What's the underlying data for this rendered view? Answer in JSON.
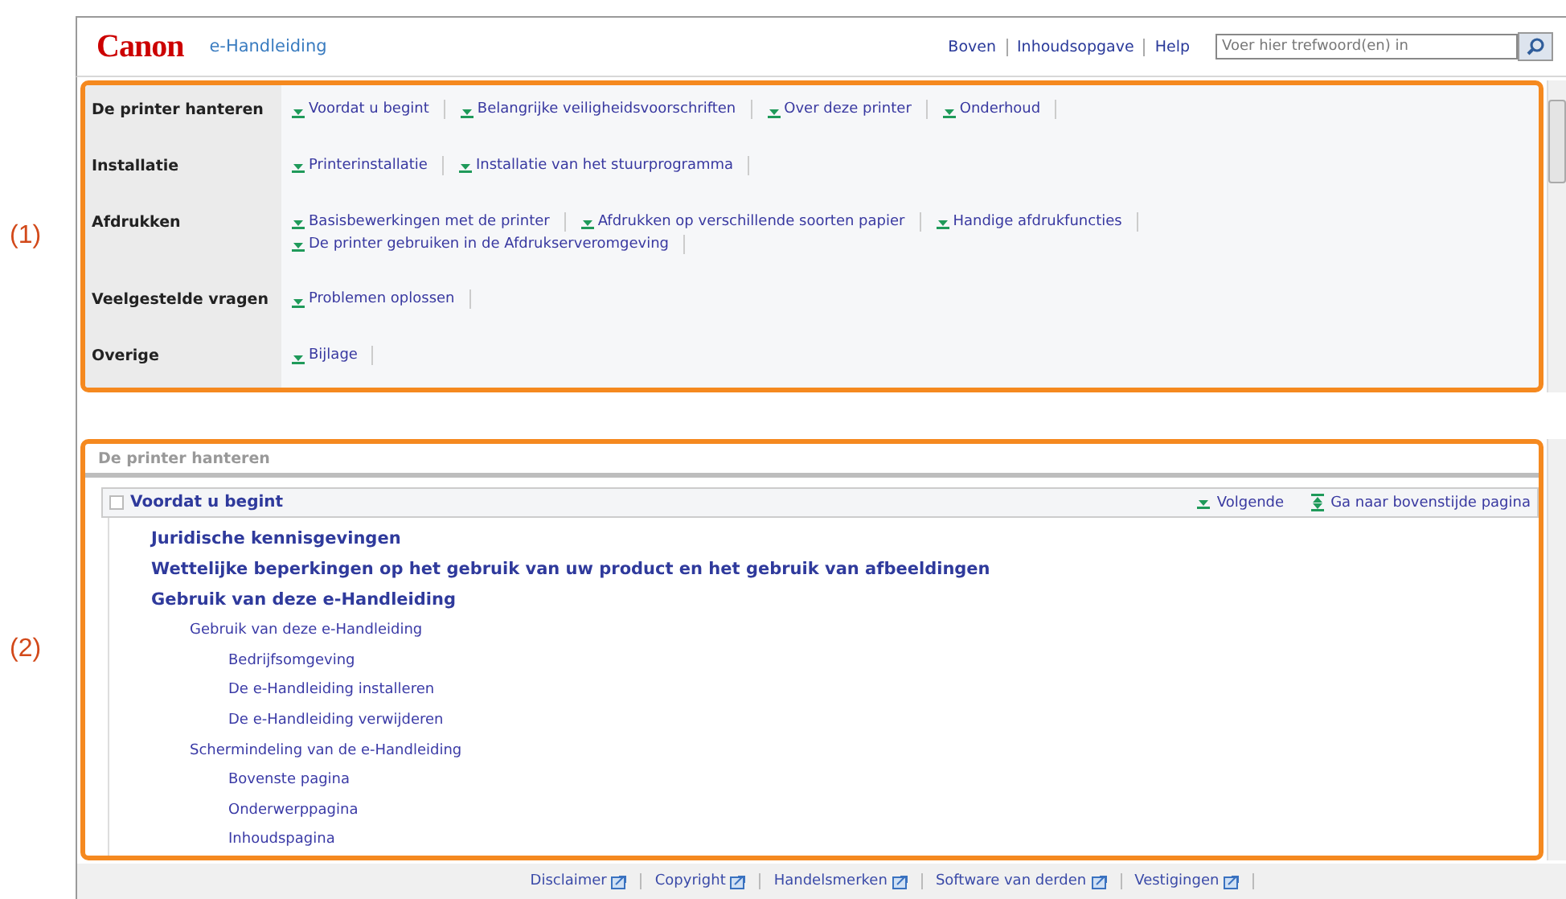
{
  "callouts": [
    "(1)",
    "(2)"
  ],
  "header": {
    "logo": "Canon",
    "title": "e-Handleiding",
    "nav": [
      "Boven",
      "Inhoudsopgave",
      "Help"
    ],
    "search": {
      "placeholder": "Voer hier trefwoord(en) in"
    }
  },
  "categories": [
    {
      "label": "De printer hanteren",
      "rows": [
        [
          "Voordat u begint",
          "Belangrijke veiligheidsvoorschriften",
          "Over deze printer",
          "Onderhoud"
        ]
      ]
    },
    {
      "label": "Installatie",
      "rows": [
        [
          "Printerinstallatie",
          "Installatie van het stuurprogramma"
        ]
      ]
    },
    {
      "label": "Afdrukken",
      "rows": [
        [
          "Basisbewerkingen met de printer",
          "Afdrukken op verschillende soorten papier",
          "Handige afdrukfuncties"
        ],
        [
          "De printer gebruiken in de Afdrukserveromgeving"
        ]
      ]
    },
    {
      "label": "Veelgestelde vragen",
      "rows": [
        [
          "Problemen oplossen"
        ]
      ]
    },
    {
      "label": "Overige",
      "rows": [
        [
          "Bijlage"
        ]
      ]
    }
  ],
  "section": {
    "title": "De printer hanteren",
    "heading": "Voordat u begint",
    "nav": [
      {
        "kind": "next",
        "label": "Volgende"
      },
      {
        "kind": "top",
        "label": "Ga naar bovenstijde pagina"
      }
    ],
    "tree": [
      {
        "label": "Juridische kennisgevingen"
      },
      {
        "label": "Wettelijke beperkingen op het gebruik van uw product en het gebruik van afbeeldingen"
      },
      {
        "label": "Gebruik van deze e-Handleiding",
        "children": [
          {
            "label": "Gebruik van deze e-Handleiding",
            "children": [
              {
                "label": "Bedrijfsomgeving"
              },
              {
                "label": "De e-Handleiding installeren"
              },
              {
                "label": "De e-Handleiding verwijderen"
              }
            ]
          },
          {
            "label": "Schermindeling van de e-Handleiding",
            "children": [
              {
                "label": "Bovenste pagina"
              },
              {
                "label": "Onderwerppagina"
              },
              {
                "label": "Inhoudspagina"
              }
            ]
          }
        ]
      }
    ]
  },
  "footer": [
    "Disclaimer",
    "Copyright",
    "Handelsmerken",
    "Software van derden",
    "Vestigingen"
  ]
}
